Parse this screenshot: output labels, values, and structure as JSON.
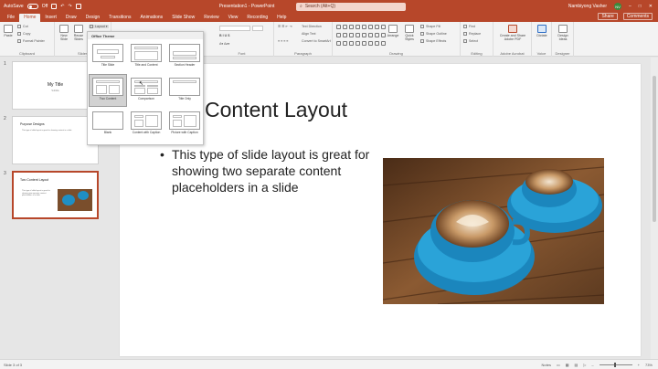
{
  "titlebar": {
    "autosave_label": "AutoSave",
    "autosave_state": "Off",
    "doc_title": "Presentation1 - PowerPoint",
    "search_placeholder": "Search (Alt+Q)",
    "user_name": "Nambiyong Vasher",
    "user_initials": "NV"
  },
  "menu": {
    "tabs": [
      "File",
      "Home",
      "Insert",
      "Draw",
      "Design",
      "Transitions",
      "Animations",
      "Slide Show",
      "Review",
      "View",
      "Recording",
      "Help"
    ],
    "active_tab": "Home",
    "share_label": "Share",
    "comments_label": "Comments"
  },
  "ribbon": {
    "groups": {
      "clipboard": "Clipboard",
      "slides": "Slides",
      "font": "Font",
      "paragraph": "Paragraph",
      "drawing": "Drawing",
      "editing": "Editing",
      "adobe": "Adobe Acrobat",
      "voice": "Voice",
      "designer": "Designer"
    },
    "paste": "Paste",
    "cut": "Cut",
    "copy": "Copy",
    "format_painter": "Format Painter",
    "new_slide": "New Slide",
    "reuse_slides": "Reuse Slides",
    "layout": "Layout",
    "text_direction": "Text Direction",
    "align_text": "Align Text",
    "convert_smartart": "Convert to SmartArt",
    "arrange": "Arrange",
    "quick_styles": "Quick Styles",
    "shape_fill": "Shape Fill",
    "shape_outline": "Shape Outline",
    "shape_effects": "Shape Effects",
    "find": "Find",
    "replace": "Replace",
    "select": "Select",
    "create_share_pdf": "Create and Share Adobe PDF",
    "dictate": "Dictate",
    "design_ideas": "Design Ideas"
  },
  "layout_menu": {
    "header": "Office Theme",
    "items": [
      {
        "label": "Title Slide"
      },
      {
        "label": "Title and Content"
      },
      {
        "label": "Section Header"
      },
      {
        "label": "Two Content"
      },
      {
        "label": "Comparison"
      },
      {
        "label": "Title Only"
      },
      {
        "label": "Blank"
      },
      {
        "label": "Content with Caption"
      },
      {
        "label": "Picture with Caption"
      }
    ],
    "selected": "Two Content"
  },
  "thumbnails": [
    {
      "num": "1",
      "title": "My Title",
      "subtitle": "Subtitle"
    },
    {
      "num": "2",
      "title": "Purpose Designs",
      "body": "This type of slide layout is great for showing content in a slide"
    },
    {
      "num": "3",
      "title": "Two Content Layout",
      "body": "This type of slide layout is great for showing two separate content placeholders in a slide"
    }
  ],
  "slide": {
    "title": "Content Layout",
    "bullet": "This type of slide layout is great for showing two separate content placeholders in a slide"
  },
  "status": {
    "slide_info": "Slide 3 of 3",
    "notes": "Notes",
    "zoom": "73%"
  },
  "colors": {
    "accent": "#b7472a",
    "cup": "#1f8fc4",
    "table": "#7a4e2c"
  }
}
